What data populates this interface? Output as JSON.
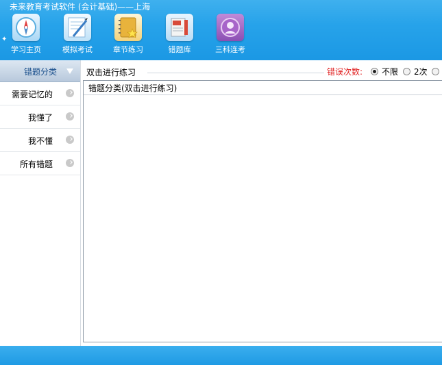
{
  "header": {
    "title": "未来教育考试软件 (会计基础)——上海",
    "toolbar": [
      {
        "label": "学习主页",
        "icon": "compass-icon"
      },
      {
        "label": "模拟考试",
        "icon": "mock-exam-icon"
      },
      {
        "label": "章节练习",
        "icon": "notebook-icon"
      },
      {
        "label": "错题库",
        "icon": "error-bank-icon"
      },
      {
        "label": "三科连考",
        "icon": "three-subjects-icon"
      }
    ]
  },
  "sidebar": {
    "header": "错题分类",
    "items": [
      {
        "label": "需要记忆的"
      },
      {
        "label": "我懂了"
      },
      {
        "label": "我不懂"
      },
      {
        "label": "所有错题"
      }
    ]
  },
  "main": {
    "group_title": "双击进行练习",
    "error_count_label": "错误次数:",
    "radio_options": [
      {
        "label": "不限",
        "checked": true
      },
      {
        "label": "2次",
        "checked": false
      },
      {
        "label": "",
        "checked": false
      }
    ],
    "list_header": "错题分类(双击进行练习)"
  },
  "colors": {
    "header_blue": "#27a3ea",
    "error_red": "#e02020",
    "sidebar_header_text": "#1a4f8c"
  }
}
